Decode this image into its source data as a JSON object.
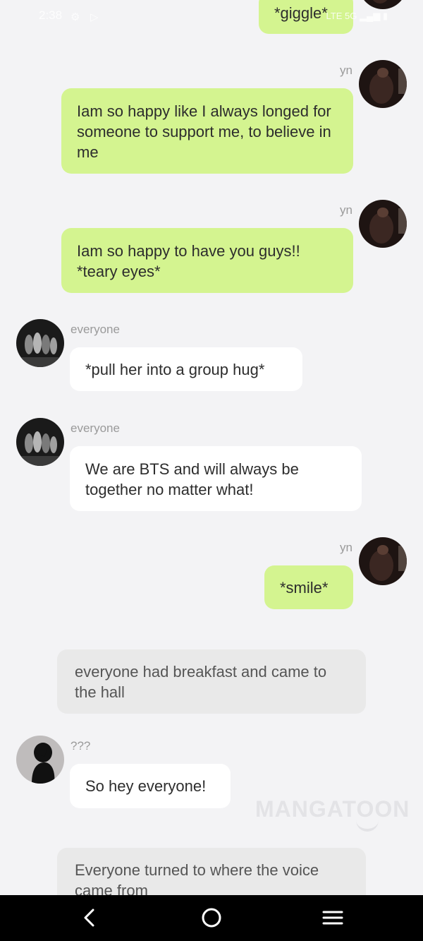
{
  "status_bar": {
    "time": "2:38",
    "network": "5G",
    "lte": "LTE"
  },
  "messages": [
    {
      "sender": "yn",
      "text": "*giggle*"
    },
    {
      "sender": "yn",
      "text": "Iam so happy like I always longed for someone to support me, to believe in me"
    },
    {
      "sender": "yn",
      "text": "Iam so happy to have you guys!! *teary eyes*"
    },
    {
      "sender": "everyone",
      "text": "*pull her into a group hug*"
    },
    {
      "sender": "everyone",
      "text": "We are BTS and will always be together no matter what!"
    },
    {
      "sender": "yn",
      "text": "*smile*"
    },
    {
      "sender": "",
      "text": "everyone had breakfast and came to the hall"
    },
    {
      "sender": "???",
      "text": "So hey everyone!"
    },
    {
      "sender": "",
      "text": "Everyone turned to where the voice came from"
    }
  ],
  "watermark": "MANGATOON",
  "icons": {
    "back": "back-icon",
    "home": "home-icon",
    "menu": "menu-icon"
  },
  "colors": {
    "my_bubble": "#d4f490",
    "other_bubble": "#ffffff",
    "narration_bubble": "#e9e9e9",
    "background": "#f3f3f5"
  }
}
